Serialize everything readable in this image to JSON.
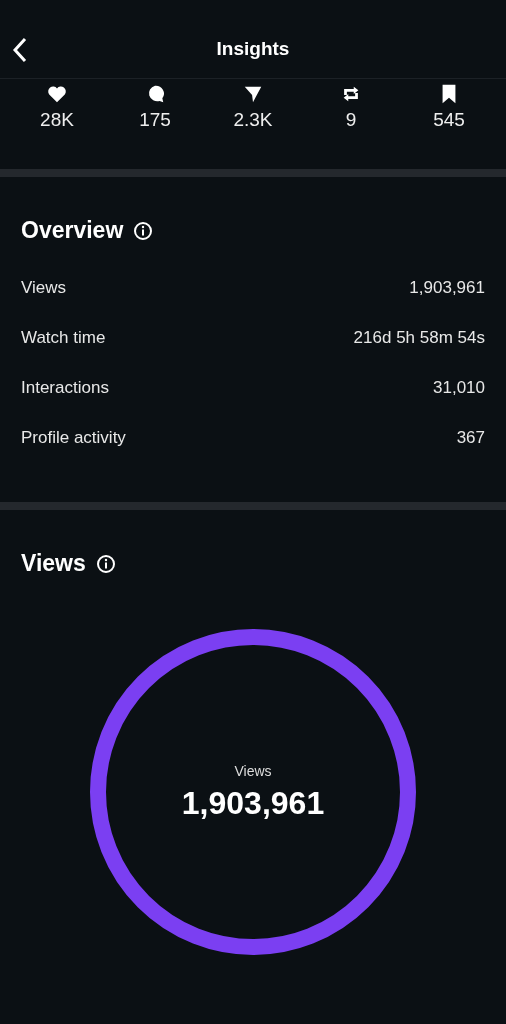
{
  "header": {
    "title": "Insights"
  },
  "stats": [
    {
      "kind": "likes",
      "value": "28K"
    },
    {
      "kind": "comments",
      "value": "175"
    },
    {
      "kind": "shares",
      "value": "2.3K"
    },
    {
      "kind": "reposts",
      "value": "9"
    },
    {
      "kind": "saves",
      "value": "545"
    }
  ],
  "overview": {
    "title": "Overview",
    "rows": [
      {
        "label": "Views",
        "value": "1,903,961"
      },
      {
        "label": "Watch time",
        "value": "216d 5h 58m 54s"
      },
      {
        "label": "Interactions",
        "value": "31,010"
      },
      {
        "label": "Profile activity",
        "value": "367"
      }
    ]
  },
  "views": {
    "title": "Views",
    "ring": {
      "label": "Views",
      "value": "1,903,961",
      "color": "#7b3ff2"
    }
  }
}
